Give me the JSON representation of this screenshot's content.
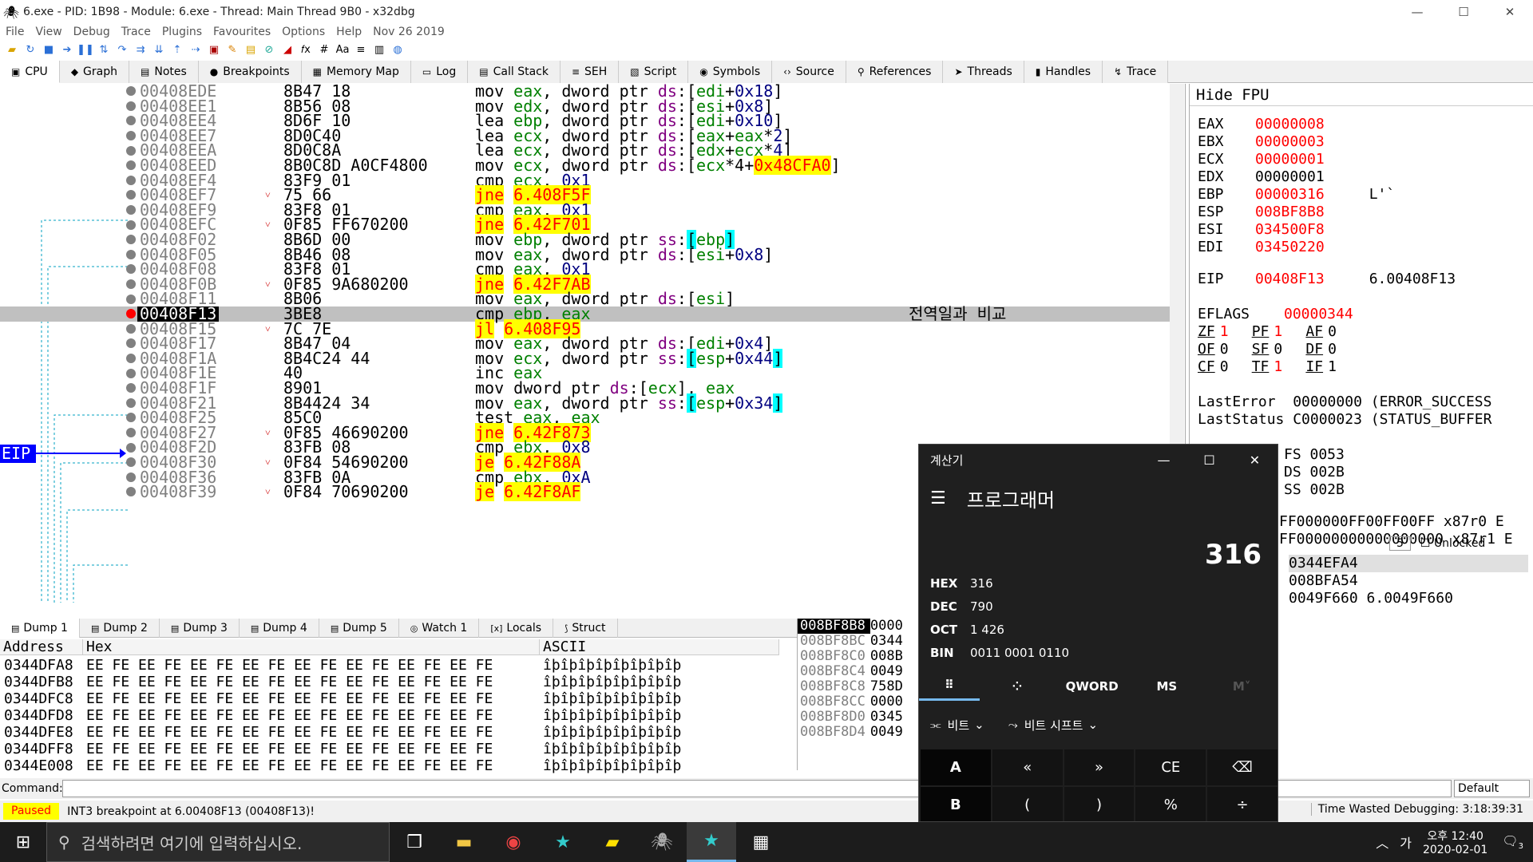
{
  "window": {
    "title": "6.exe - PID: 1B98 - Module: 6.exe - Thread: Main Thread 9B0 - x32dbg",
    "min": "—",
    "max": "☐",
    "close": "✕"
  },
  "menu": [
    "File",
    "View",
    "Debug",
    "Trace",
    "Plugins",
    "Favourites",
    "Options",
    "Help",
    "Nov 26 2019"
  ],
  "tabs": [
    {
      "icon": "cpu-icon",
      "glyph": "▣",
      "label": "CPU"
    },
    {
      "icon": "graph-icon",
      "glyph": "◆",
      "label": "Graph"
    },
    {
      "icon": "notes-icon",
      "glyph": "▤",
      "label": "Notes"
    },
    {
      "icon": "breakpoint-icon",
      "glyph": "●",
      "label": "Breakpoints"
    },
    {
      "icon": "memory-icon",
      "glyph": "▦",
      "label": "Memory Map"
    },
    {
      "icon": "log-icon",
      "glyph": "▭",
      "label": "Log"
    },
    {
      "icon": "callstack-icon",
      "glyph": "▤",
      "label": "Call Stack"
    },
    {
      "icon": "seh-icon",
      "glyph": "≡",
      "label": "SEH"
    },
    {
      "icon": "script-icon",
      "glyph": "▧",
      "label": "Script"
    },
    {
      "icon": "symbols-icon",
      "glyph": "◉",
      "label": "Symbols"
    },
    {
      "icon": "source-icon",
      "glyph": "‹›",
      "label": "Source"
    },
    {
      "icon": "references-icon",
      "glyph": "⚲",
      "label": "References"
    },
    {
      "icon": "threads-icon",
      "glyph": "➤",
      "label": "Threads"
    },
    {
      "icon": "handles-icon",
      "glyph": "▮",
      "label": "Handles"
    },
    {
      "icon": "trace-icon",
      "glyph": "↯",
      "label": "Trace"
    }
  ],
  "disasm": [
    {
      "addr": "00408EDE",
      "bytes": "8B47 18",
      "m": "mov",
      "ops": [
        [
          "reg",
          "eax"
        ],
        [
          "op",
          ", "
        ],
        [
          "kw",
          "dword ptr "
        ],
        [
          "seg",
          "ds"
        ],
        [
          "op",
          ":["
        ],
        [
          "reg",
          "edi"
        ],
        [
          "op",
          "+"
        ],
        [
          "num",
          "0x18"
        ],
        [
          "op",
          "]"
        ]
      ]
    },
    {
      "addr": "00408EE1",
      "bytes": "8B56 08",
      "m": "mov",
      "ops": [
        [
          "reg",
          "edx"
        ],
        [
          "op",
          ", "
        ],
        [
          "kw",
          "dword ptr "
        ],
        [
          "seg",
          "ds"
        ],
        [
          "op",
          ":["
        ],
        [
          "reg",
          "esi"
        ],
        [
          "op",
          "+"
        ],
        [
          "num",
          "0x8"
        ],
        [
          "op",
          "]"
        ]
      ]
    },
    {
      "addr": "00408EE4",
      "bytes": "8D6F 10",
      "m": "lea",
      "ops": [
        [
          "reg",
          "ebp"
        ],
        [
          "op",
          ", "
        ],
        [
          "kw",
          "dword ptr "
        ],
        [
          "seg",
          "ds"
        ],
        [
          "op",
          ":["
        ],
        [
          "reg",
          "edi"
        ],
        [
          "op",
          "+"
        ],
        [
          "num",
          "0x10"
        ],
        [
          "op",
          "]"
        ]
      ]
    },
    {
      "addr": "00408EE7",
      "bytes": "8D0C40",
      "m": "lea",
      "ops": [
        [
          "reg",
          "ecx"
        ],
        [
          "op",
          ", "
        ],
        [
          "kw",
          "dword ptr "
        ],
        [
          "seg",
          "ds"
        ],
        [
          "op",
          ":["
        ],
        [
          "reg",
          "eax"
        ],
        [
          "op",
          "+"
        ],
        [
          "reg",
          "eax"
        ],
        [
          "op",
          "*"
        ],
        [
          "num",
          "2"
        ],
        [
          "op",
          "]"
        ]
      ]
    },
    {
      "addr": "00408EEA",
      "bytes": "8D0C8A",
      "m": "lea",
      "ops": [
        [
          "reg",
          "ecx"
        ],
        [
          "op",
          ", "
        ],
        [
          "kw",
          "dword ptr "
        ],
        [
          "seg",
          "ds"
        ],
        [
          "op",
          ":["
        ],
        [
          "reg",
          "edx"
        ],
        [
          "op",
          "+"
        ],
        [
          "reg",
          "ecx"
        ],
        [
          "op",
          "*"
        ],
        [
          "num",
          "4"
        ],
        [
          "op",
          "]"
        ]
      ]
    },
    {
      "addr": "00408EED",
      "bytes": "8B0C8D A0CF4800",
      "m": "mov",
      "ops": [
        [
          "reg",
          "ecx"
        ],
        [
          "op",
          ", "
        ],
        [
          "kw",
          "dword ptr "
        ],
        [
          "seg",
          "ds"
        ],
        [
          "op",
          ":["
        ],
        [
          "reg",
          "ecx"
        ],
        [
          "op",
          "*4+"
        ],
        [
          "jmp",
          "0x48CFA0"
        ],
        [
          "op",
          "]"
        ]
      ]
    },
    {
      "addr": "00408EF4",
      "bytes": "83F9 01",
      "m": "cmp",
      "ops": [
        [
          "reg",
          "ecx"
        ],
        [
          "op",
          ", "
        ],
        [
          "num",
          "0x1"
        ]
      ]
    },
    {
      "addr": "00408EF7",
      "bytes": "75 66",
      "m": "jne",
      "j": true,
      "arrow": true,
      "ops": [
        [
          "jt",
          "6.408F5F"
        ]
      ]
    },
    {
      "addr": "00408EF9",
      "bytes": "83F8 01",
      "m": "cmp",
      "ops": [
        [
          "reg",
          "eax"
        ],
        [
          "op",
          ", "
        ],
        [
          "num",
          "0x1"
        ]
      ]
    },
    {
      "addr": "00408EFC",
      "bytes": "0F85 FF670200",
      "m": "jne",
      "j": true,
      "arrow": true,
      "ops": [
        [
          "jt",
          "6.42F701"
        ]
      ]
    },
    {
      "addr": "00408F02",
      "bytes": "8B6D 00",
      "m": "mov",
      "ops": [
        [
          "reg",
          "ebp"
        ],
        [
          "op",
          ", "
        ],
        [
          "kw",
          "dword ptr "
        ],
        [
          "seg",
          "ss"
        ],
        [
          "op",
          ":"
        ],
        [
          "brk",
          "["
        ],
        [
          "reg",
          "ebp"
        ],
        [
          "brk",
          "]"
        ]
      ]
    },
    {
      "addr": "00408F05",
      "bytes": "8B46 08",
      "m": "mov",
      "ops": [
        [
          "reg",
          "eax"
        ],
        [
          "op",
          ", "
        ],
        [
          "kw",
          "dword ptr "
        ],
        [
          "seg",
          "ds"
        ],
        [
          "op",
          ":["
        ],
        [
          "reg",
          "esi"
        ],
        [
          "op",
          "+"
        ],
        [
          "num",
          "0x8"
        ],
        [
          "op",
          "]"
        ]
      ]
    },
    {
      "addr": "00408F08",
      "bytes": "83F8 01",
      "m": "cmp",
      "ops": [
        [
          "reg",
          "eax"
        ],
        [
          "op",
          ", "
        ],
        [
          "num",
          "0x1"
        ]
      ]
    },
    {
      "addr": "00408F0B",
      "bytes": "0F85 9A680200",
      "m": "jne",
      "j": true,
      "arrow": true,
      "ops": [
        [
          "jt",
          "6.42F7AB"
        ]
      ]
    },
    {
      "addr": "00408F11",
      "bytes": "8B06",
      "m": "mov",
      "ops": [
        [
          "reg",
          "eax"
        ],
        [
          "op",
          ", "
        ],
        [
          "kw",
          "dword ptr "
        ],
        [
          "seg",
          "ds"
        ],
        [
          "op",
          ":["
        ],
        [
          "reg",
          "esi"
        ],
        [
          "op",
          "]"
        ]
      ]
    },
    {
      "addr": "00408F13",
      "bytes": "3BE8",
      "m": "cmp",
      "eip": true,
      "cmt": "전역일과 비교",
      "ops": [
        [
          "reg",
          "ebp"
        ],
        [
          "op",
          ", "
        ],
        [
          "reg",
          "eax"
        ]
      ]
    },
    {
      "addr": "00408F15",
      "bytes": "7C 7E",
      "m": "jl",
      "j": true,
      "arrow": true,
      "ops": [
        [
          "jt",
          "6.408F95"
        ]
      ]
    },
    {
      "addr": "00408F17",
      "bytes": "8B47 04",
      "m": "mov",
      "ops": [
        [
          "reg",
          "eax"
        ],
        [
          "op",
          ", "
        ],
        [
          "kw",
          "dword ptr "
        ],
        [
          "seg",
          "ds"
        ],
        [
          "op",
          ":["
        ],
        [
          "reg",
          "edi"
        ],
        [
          "op",
          "+"
        ],
        [
          "num",
          "0x4"
        ],
        [
          "op",
          "]"
        ]
      ]
    },
    {
      "addr": "00408F1A",
      "bytes": "8B4C24 44",
      "m": "mov",
      "ops": [
        [
          "reg",
          "ecx"
        ],
        [
          "op",
          ", "
        ],
        [
          "kw",
          "dword ptr "
        ],
        [
          "seg",
          "ss"
        ],
        [
          "op",
          ":"
        ],
        [
          "brk",
          "["
        ],
        [
          "reg",
          "esp"
        ],
        [
          "op",
          "+"
        ],
        [
          "num",
          "0x44"
        ],
        [
          "brk",
          "]"
        ]
      ]
    },
    {
      "addr": "00408F1E",
      "bytes": "40",
      "m": "inc",
      "ops": [
        [
          "reg",
          "eax"
        ]
      ]
    },
    {
      "addr": "00408F1F",
      "bytes": "8901",
      "m": "mov",
      "ops": [
        [
          "kw",
          "dword ptr "
        ],
        [
          "seg",
          "ds"
        ],
        [
          "op",
          ":["
        ],
        [
          "reg",
          "ecx"
        ],
        [
          "op",
          "], "
        ],
        [
          "reg",
          "eax"
        ]
      ]
    },
    {
      "addr": "00408F21",
      "bytes": "8B4424 34",
      "m": "mov",
      "ops": [
        [
          "reg",
          "eax"
        ],
        [
          "op",
          ", "
        ],
        [
          "kw",
          "dword ptr "
        ],
        [
          "seg",
          "ss"
        ],
        [
          "op",
          ":"
        ],
        [
          "brk",
          "["
        ],
        [
          "reg",
          "esp"
        ],
        [
          "op",
          "+"
        ],
        [
          "num",
          "0x34"
        ],
        [
          "brk",
          "]"
        ]
      ]
    },
    {
      "addr": "00408F25",
      "bytes": "85C0",
      "m": "test",
      "ops": [
        [
          "reg",
          "eax"
        ],
        [
          "op",
          ", "
        ],
        [
          "reg",
          "eax"
        ]
      ]
    },
    {
      "addr": "00408F27",
      "bytes": "0F85 46690200",
      "m": "jne",
      "j": true,
      "arrow": true,
      "ops": [
        [
          "jt",
          "6.42F873"
        ]
      ]
    },
    {
      "addr": "00408F2D",
      "bytes": "83FB 08",
      "m": "cmp",
      "ops": [
        [
          "reg",
          "ebx"
        ],
        [
          "op",
          ", "
        ],
        [
          "num",
          "0x8"
        ]
      ]
    },
    {
      "addr": "00408F30",
      "bytes": "0F84 54690200",
      "m": "je",
      "j": true,
      "arrow": true,
      "ops": [
        [
          "jt",
          "6.42F88A"
        ]
      ]
    },
    {
      "addr": "00408F36",
      "bytes": "83FB 0A",
      "m": "cmp",
      "ops": [
        [
          "reg",
          "ebx"
        ],
        [
          "op",
          ", "
        ],
        [
          "num",
          "0xA"
        ]
      ]
    },
    {
      "addr": "00408F39",
      "bytes": "0F84 70690200",
      "m": "je",
      "j": true,
      "arrow": true,
      "ops": [
        [
          "jt",
          "6.42F8AF"
        ]
      ]
    }
  ],
  "eip_label": "EIP",
  "regs_header": "Hide FPU",
  "regs": [
    {
      "n": "EAX",
      "v": "00000008",
      "red": true
    },
    {
      "n": "EBX",
      "v": "00000003",
      "red": true
    },
    {
      "n": "ECX",
      "v": "00000001",
      "red": true
    },
    {
      "n": "EDX",
      "v": "00000001",
      "red": false
    },
    {
      "n": "EBP",
      "v": "00000316",
      "red": true,
      "extra": "L'`"
    },
    {
      "n": "ESP",
      "v": "008BF8B8",
      "red": true
    },
    {
      "n": "ESI",
      "v": "034500F8",
      "red": true
    },
    {
      "n": "EDI",
      "v": "03450220",
      "red": true
    }
  ],
  "eip": {
    "n": "EIP",
    "v": "00408F13",
    "sym": "6.00408F13"
  },
  "eflags": {
    "n": "EFLAGS",
    "v": "00000344"
  },
  "flags": [
    [
      [
        "ZF",
        "1",
        true
      ],
      [
        "PF",
        "1",
        true
      ],
      [
        "AF",
        "0",
        false
      ]
    ],
    [
      [
        "OF",
        "0",
        false
      ],
      [
        "SF",
        "0",
        false
      ],
      [
        "DF",
        "0",
        false
      ]
    ],
    [
      [
        "CF",
        "0",
        false
      ],
      [
        "TF",
        "1",
        true
      ],
      [
        "IF",
        "1",
        false
      ]
    ]
  ],
  "lasterror": "LastError  00000000 (ERROR_SUCCESS",
  "laststatus": "LastStatus C0000023 (STATUS_BUFFER",
  "segs": [
    "FS 0053",
    "DS 002B",
    "SS 002B"
  ],
  "fpu": [
    "FF000000FF00FF00FF x87r0 E",
    "FF00000000000000000 x87r1 E"
  ],
  "stackctrl": {
    "count": "5",
    "unlocked": "Unlocked"
  },
  "stackargs": [
    "0344EFA4",
    "008BFA54",
    "0049F660 6.0049F660"
  ],
  "dumptabs": [
    "Dump 1",
    "Dump 2",
    "Dump 3",
    "Dump 4",
    "Dump 5",
    "Watch 1",
    "Locals",
    "Struct"
  ],
  "dumpheaders": {
    "addr": "Address",
    "hex": "Hex",
    "ascii": "ASCII"
  },
  "dump": [
    {
      "a": "0344DFA8",
      "h": "EE FE EE FE EE FE EE FE EE FE EE FE EE FE EE FE",
      "c": "îþîþîþîþîþîþîþîþ"
    },
    {
      "a": "0344DFB8",
      "h": "EE FE EE FE EE FE EE FE EE FE EE FE EE FE EE FE",
      "c": "îþîþîþîþîþîþîþîþ"
    },
    {
      "a": "0344DFC8",
      "h": "EE FE EE FE EE FE EE FE EE FE EE FE EE FE EE FE",
      "c": "îþîþîþîþîþîþîþîþ"
    },
    {
      "a": "0344DFD8",
      "h": "EE FE EE FE EE FE EE FE EE FE EE FE EE FE EE FE",
      "c": "îþîþîþîþîþîþîþîþ"
    },
    {
      "a": "0344DFE8",
      "h": "EE FE EE FE EE FE EE FE EE FE EE FE EE FE EE FE",
      "c": "îþîþîþîþîþîþîþîþ"
    },
    {
      "a": "0344DFF8",
      "h": "EE FE EE FE EE FE EE FE EE FE EE FE EE FE EE FE",
      "c": "îþîþîþîþîþîþîþîþ"
    },
    {
      "a": "0344E008",
      "h": "EE FE EE FE EE FE EE FE EE FE EE FE EE FE EE FE",
      "c": "îþîþîþîþîþîþîþîþ"
    }
  ],
  "stack": [
    {
      "a": "008BF8B8",
      "v": "0000"
    },
    {
      "a": "008BF8BC",
      "v": "0344"
    },
    {
      "a": "008BF8C0",
      "v": "008B"
    },
    {
      "a": "008BF8C4",
      "v": "0049"
    },
    {
      "a": "008BF8C8",
      "v": "758D"
    },
    {
      "a": "008BF8CC",
      "v": "0000"
    },
    {
      "a": "008BF8D0",
      "v": "0345"
    },
    {
      "a": "008BF8D4",
      "v": "0049"
    }
  ],
  "command": {
    "label": "Command:",
    "default": "Default"
  },
  "status": {
    "paused": "Paused",
    "msg": "INT3 breakpoint at 6.00408F13 (00408F13)!",
    "time": "Time Wasted Debugging: 3:18:39:31"
  },
  "calc": {
    "title": "계산기",
    "mode": "프로그래머",
    "display": "316",
    "bases": [
      [
        "HEX",
        "316"
      ],
      [
        "DEC",
        "790"
      ],
      [
        "OCT",
        "1 426"
      ],
      [
        "BIN",
        "0011 0001 0110"
      ]
    ],
    "modes": [
      "⠿",
      "⁘",
      "QWORD",
      "MS",
      "M˅"
    ],
    "bit": "비트",
    "shift": "비트 시프트",
    "keys": [
      "A",
      "«",
      "»",
      "CE",
      "⌫",
      "B",
      "(",
      ")",
      "%",
      "÷"
    ]
  },
  "taskbar": {
    "search": "검색하려면 여기에 입력하십시오.",
    "time": "오후 12:40",
    "date": "2020-02-01",
    "ime": "가",
    "notif": "3"
  }
}
